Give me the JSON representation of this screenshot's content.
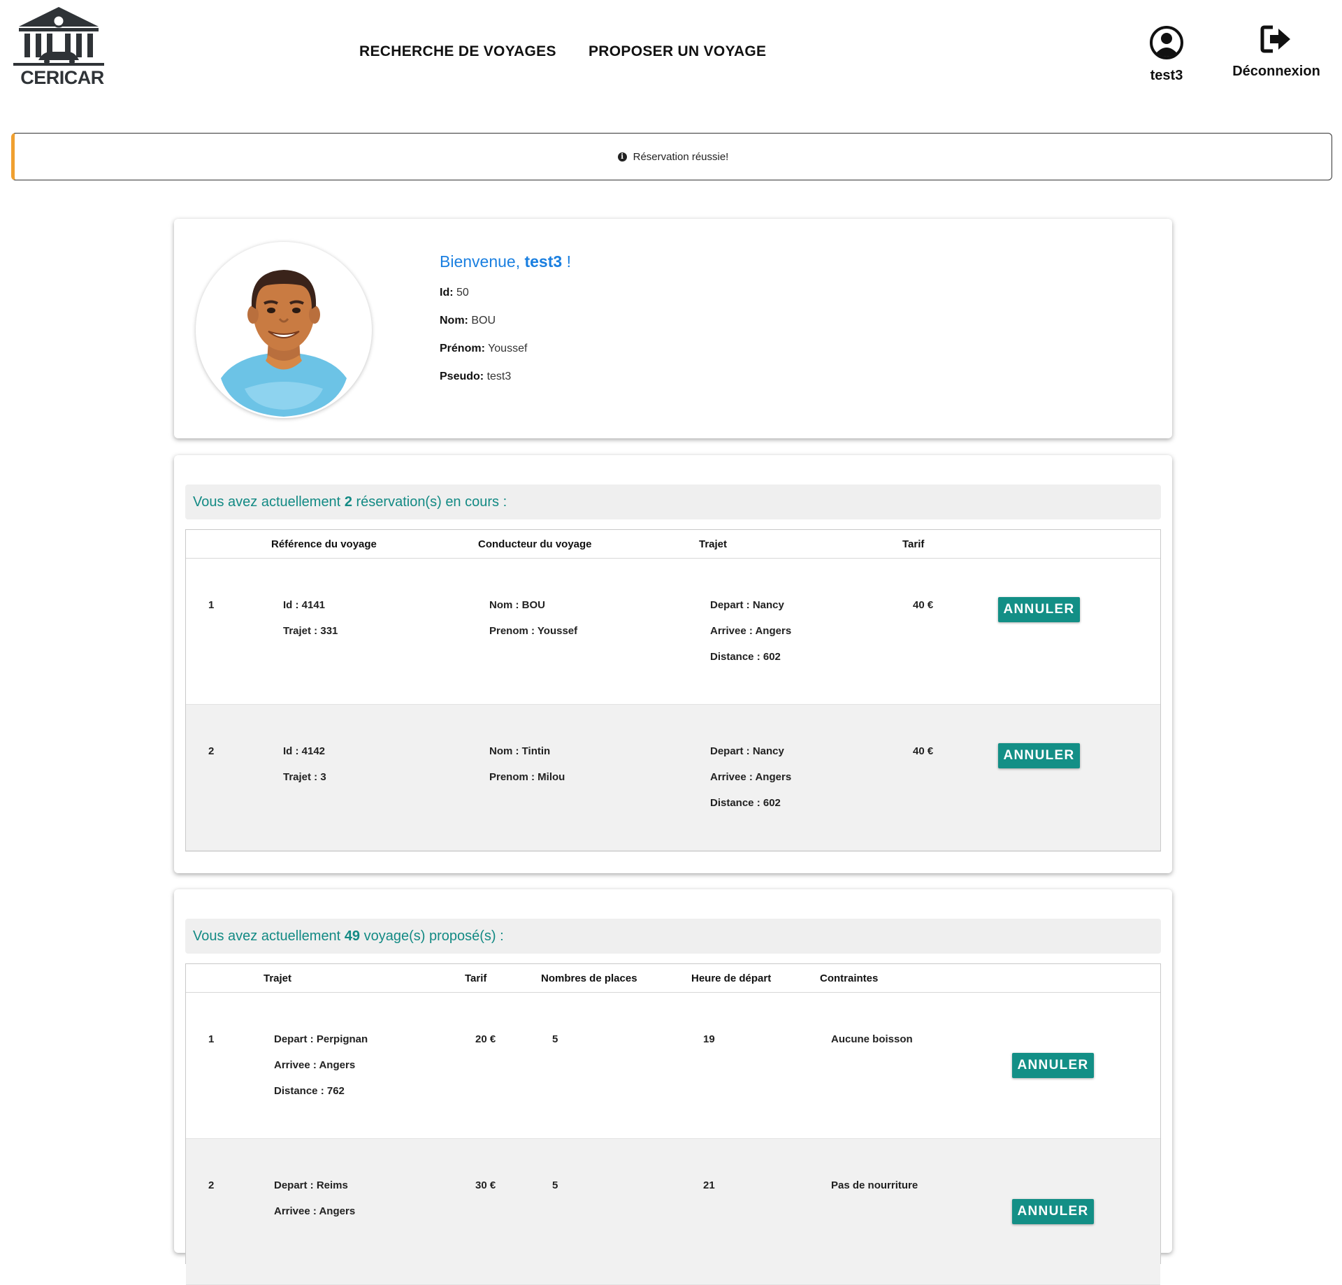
{
  "header": {
    "logo_text": "CERICAR",
    "nav": [
      {
        "label": "RECHERCHE DE VOYAGES"
      },
      {
        "label": "PROPOSER UN VOYAGE"
      }
    ],
    "user_label": "test3",
    "logout_label": "Déconnexion",
    "icons": {
      "user": "user-circle-icon",
      "logout": "sign-out-icon"
    }
  },
  "alert": {
    "message": "Réservation réussie!",
    "icon": "info-circle-icon",
    "accent_color": "#f0a030"
  },
  "profile": {
    "welcome_prefix": "Bienvenue,",
    "username": "test3",
    "welcome_suffix": "!",
    "fields": [
      {
        "label": "Id:",
        "value": "50"
      },
      {
        "label": "Nom:",
        "value": "BOU"
      },
      {
        "label": "Prénom:",
        "value": "Youssef"
      },
      {
        "label": "Pseudo:",
        "value": "test3"
      }
    ]
  },
  "reservations": {
    "banner_prefix": "Vous avez actuellement",
    "count": "2",
    "banner_suffix": "réservation(s) en cours :",
    "headers": [
      "Référence du voyage",
      "Conducteur du voyage",
      "Trajet",
      "Tarif"
    ],
    "rows": [
      {
        "num": "1",
        "ref": [
          "Id : 4141",
          "Trajet : 331"
        ],
        "driver": [
          "Nom : BOU",
          "Prenom : Youssef"
        ],
        "trajet": [
          "Depart : Nancy",
          "Arrivee : Angers",
          "Distance : 602"
        ],
        "tarif": "40 €",
        "button": "ANNULER"
      },
      {
        "num": "2",
        "ref": [
          "Id : 4142",
          "Trajet : 3"
        ],
        "driver": [
          "Nom : Tintin",
          "Prenom : Milou"
        ],
        "trajet": [
          "Depart : Nancy",
          "Arrivee : Angers",
          "Distance : 602"
        ],
        "tarif": "40 €",
        "button": "ANNULER"
      }
    ]
  },
  "trips": {
    "banner_prefix": "Vous avez actuellement",
    "count": "49",
    "banner_suffix": "voyage(s) proposé(s) :",
    "headers": [
      "Trajet",
      "Tarif",
      "Nombres de places",
      "Heure de départ",
      "Contraintes"
    ],
    "rows": [
      {
        "num": "1",
        "trajet": [
          "Depart : Perpignan",
          "Arrivee : Angers",
          "Distance : 762"
        ],
        "tarif": "20 €",
        "places": "5",
        "heure": "19",
        "contraintes": "Aucune boisson",
        "button": "ANNULER"
      },
      {
        "num": "2",
        "trajet": [
          "Depart : Reims",
          "Arrivee : Angers"
        ],
        "tarif": "30 €",
        "places": "5",
        "heure": "21",
        "contraintes": "Pas de nourriture",
        "button": "ANNULER"
      }
    ]
  },
  "colors": {
    "teal": "#138f86",
    "welcome_blue": "#1a7fe0",
    "banner_text": "#138a84"
  }
}
